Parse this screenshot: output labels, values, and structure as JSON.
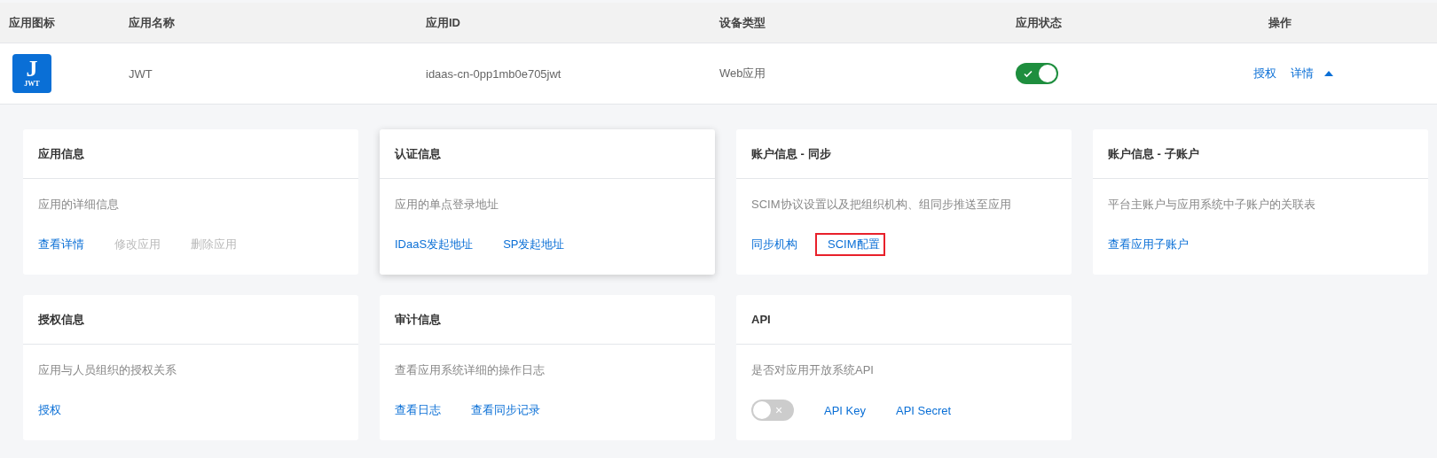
{
  "table": {
    "columns": [
      "应用图标",
      "应用名称",
      "应用ID",
      "设备类型",
      "应用状态",
      "操作"
    ],
    "rows": [
      {
        "icon_letter": "J",
        "icon_caption": "JWT",
        "name": "JWT",
        "app_id": "idaas-cn-0pp1mb0e705jwt",
        "device_type": "Web应用",
        "enabled": true,
        "actions": [
          "授权",
          "详情"
        ],
        "expanded": true
      }
    ]
  },
  "cards": [
    {
      "title": "应用信息",
      "description": "应用的详细信息",
      "raised": false,
      "links": [
        {
          "label": "查看详情",
          "disabled": false,
          "highlighted": false
        },
        {
          "label": "修改应用",
          "disabled": true,
          "highlighted": false
        },
        {
          "label": "删除应用",
          "disabled": true,
          "highlighted": false
        }
      ]
    },
    {
      "title": "认证信息",
      "description": "应用的单点登录地址",
      "raised": true,
      "links": [
        {
          "label": "IDaaS发起地址",
          "disabled": false,
          "highlighted": false
        },
        {
          "label": "SP发起地址",
          "disabled": false,
          "highlighted": false
        }
      ]
    },
    {
      "title": "账户信息 - 同步",
      "description": "SCIM协议设置以及把组织机构、组同步推送至应用",
      "raised": false,
      "links": [
        {
          "label": "同步机构",
          "disabled": false,
          "highlighted": false
        },
        {
          "label": "SCIM配置",
          "disabled": false,
          "highlighted": true
        }
      ]
    },
    {
      "title": "账户信息 - 子账户",
      "description": "平台主账户与应用系统中子账户的关联表",
      "raised": false,
      "links": [
        {
          "label": "查看应用子账户",
          "disabled": false,
          "highlighted": false
        }
      ]
    },
    {
      "title": "授权信息",
      "description": "应用与人员组织的授权关系",
      "raised": false,
      "links": [
        {
          "label": "授权",
          "disabled": false,
          "highlighted": false
        }
      ]
    },
    {
      "title": "审计信息",
      "description": "查看应用系统详细的操作日志",
      "raised": false,
      "links": [
        {
          "label": "查看日志",
          "disabled": false,
          "highlighted": false
        },
        {
          "label": "查看同步记录",
          "disabled": false,
          "highlighted": false
        }
      ]
    },
    {
      "title": "API",
      "description": "是否对应用开放系统API",
      "raised": false,
      "api_switch": {
        "on": false,
        "symbol": "×"
      },
      "links": [
        {
          "label": "API Key",
          "disabled": false,
          "highlighted": false
        },
        {
          "label": "API Secret",
          "disabled": false,
          "highlighted": false
        }
      ]
    }
  ]
}
